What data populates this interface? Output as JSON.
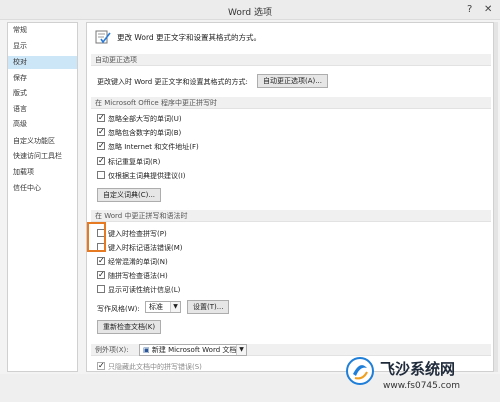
{
  "window": {
    "title": "Word 选项",
    "help": "?",
    "close": "✕"
  },
  "sidebar": {
    "items": [
      {
        "label": "常规"
      },
      {
        "label": "显示"
      },
      {
        "label": "校对"
      },
      {
        "label": "保存"
      },
      {
        "label": "版式"
      },
      {
        "label": "语言"
      },
      {
        "label": "高级"
      },
      {
        "label": "自定义功能区"
      },
      {
        "label": "快速访问工具栏"
      },
      {
        "label": "加载项"
      },
      {
        "label": "信任中心"
      }
    ],
    "active_index": 2
  },
  "header": {
    "text": "更改 Word 更正文字和设置其格式的方式。"
  },
  "autocorrect": {
    "section": "自动更正选项",
    "label": "更改键入时 Word 更正文字和设置其格式的方式:",
    "button": "自动更正选项(A)..."
  },
  "office": {
    "section": "在 Microsoft Office 程序中更正拼写时",
    "checks": [
      {
        "label": "忽略全部大写的单词(U)",
        "checked": true
      },
      {
        "label": "忽略包含数字的单词(B)",
        "checked": true
      },
      {
        "label": "忽略 Internet 和文件地址(F)",
        "checked": true
      },
      {
        "label": "标记重复单词(R)",
        "checked": true
      },
      {
        "label": "仅根据主词典提供建议(I)",
        "checked": false
      }
    ],
    "custom_dict_button": "自定义词典(C)..."
  },
  "word": {
    "section": "在 Word 中更正拼写和语法时",
    "checks": [
      {
        "label": "键入时检查拼写(P)",
        "checked": false
      },
      {
        "label": "键入时标记语法错误(M)",
        "checked": false
      },
      {
        "label": "经常混淆的单词(N)",
        "checked": true
      },
      {
        "label": "随拼写检查语法(H)",
        "checked": true
      },
      {
        "label": "显示可读性统计信息(L)",
        "checked": false
      }
    ],
    "style_label": "写作风格(W):",
    "style_value": "标准",
    "settings_button": "设置(T)...",
    "recheck_button": "重新检查文档(K)"
  },
  "exceptions": {
    "label": "例外项(X):",
    "doc_value": "新建 Microsoft Word 文档",
    "hide_spelling": "只隐藏此文档中的拼写错误(S)"
  },
  "watermark": {
    "text": "飞沙系统网",
    "url": "www.fs0745.com"
  }
}
